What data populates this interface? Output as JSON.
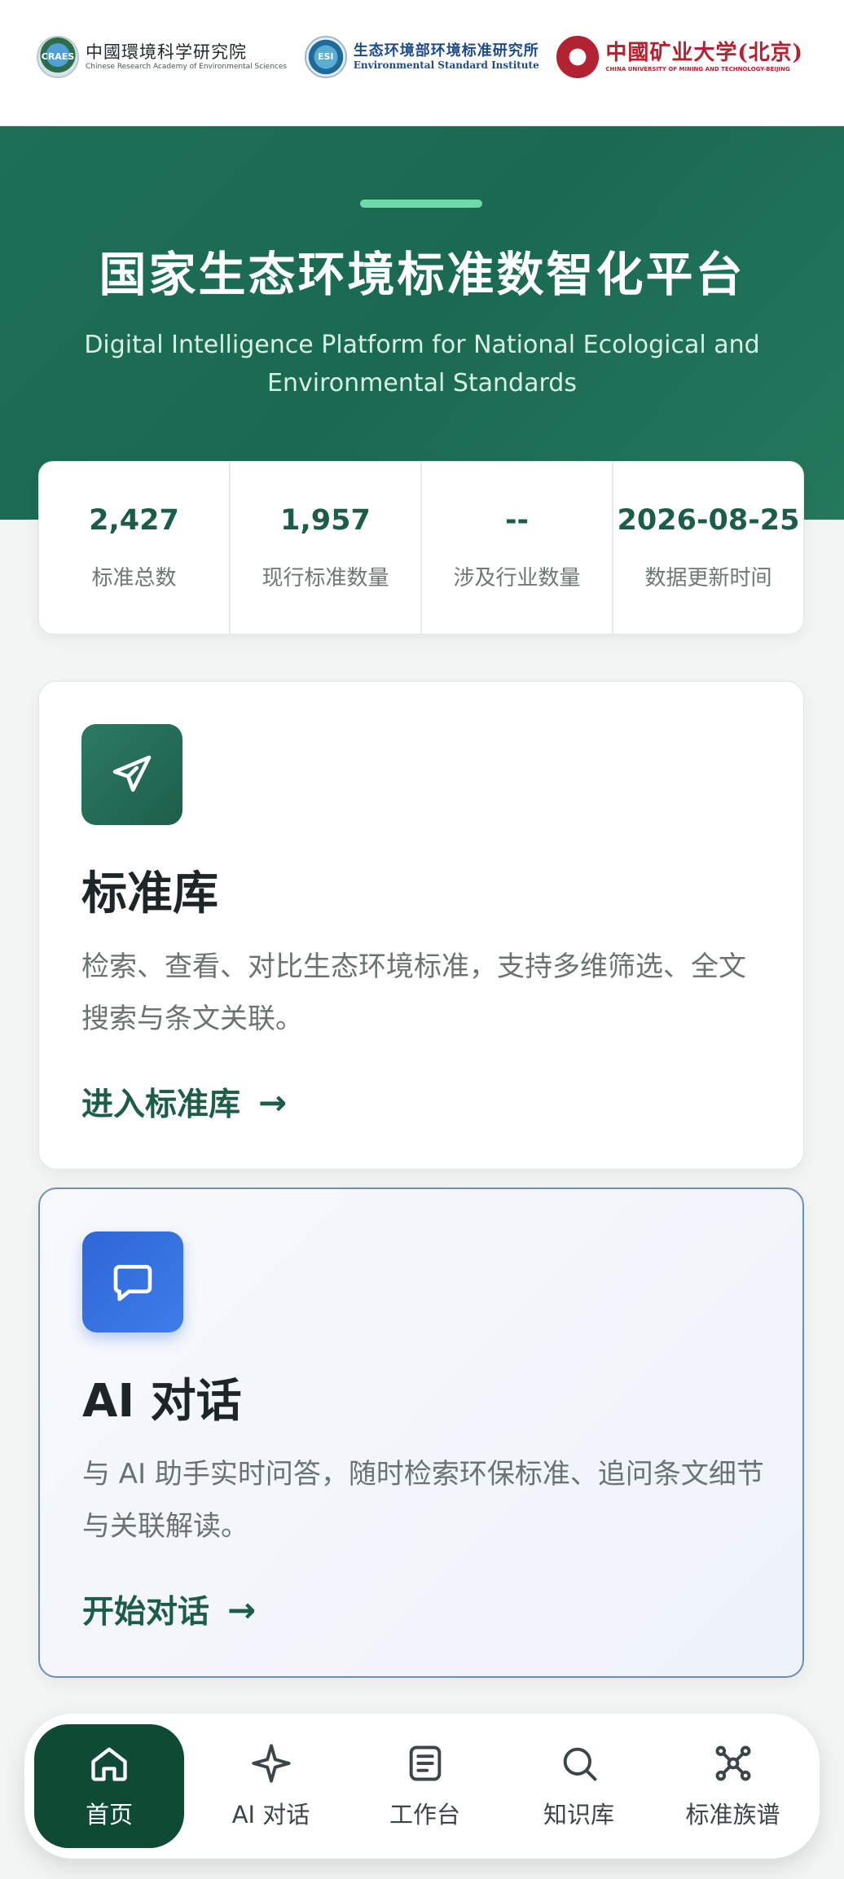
{
  "header": {
    "logos": [
      {
        "cn": "中國環境科学研究院",
        "en": "Chinese Research Academy of Environmental Sciences",
        "seal": "CRAES"
      },
      {
        "cn": "生态环境部环境标准研究所",
        "en": "Environmental Standard Institute",
        "seal": "ESI"
      },
      {
        "cn": "中國矿业大学(北京)",
        "en": "CHINA UNIVERSITY OF MINING AND TECHNOLOGY-BEIJING"
      }
    ]
  },
  "hero": {
    "title": "国家生态环境标准数智化平台",
    "subtitle": "Digital Intelligence Platform for National Ecological and Environmental Standards"
  },
  "stats": [
    {
      "value": "2,427",
      "label": "标准总数"
    },
    {
      "value": "1,957",
      "label": "现行标准数量"
    },
    {
      "value": "--",
      "label": "涉及行业数量"
    },
    {
      "value": "2026-08-25",
      "label": "数据更新时间"
    }
  ],
  "cards": {
    "standards": {
      "icon": "send-icon",
      "title": "标准库",
      "description": "检索、查看、对比生态环境标准，支持多维筛选、全文搜索与条文关联。",
      "link": "进入标准库",
      "arrow": "→"
    },
    "ai": {
      "icon": "chat-bubble-icon",
      "title": "AI 对话",
      "description": "与 AI 助手实时问答，随时检索环保标准、追问条文细节与关联解读。",
      "link": "开始对话",
      "arrow": "→"
    }
  },
  "bottom_nav": [
    {
      "label": "首页",
      "icon": "home-icon",
      "active": true
    },
    {
      "label": "AI 对话",
      "icon": "sparkle-icon",
      "active": false
    },
    {
      "label": "工作台",
      "icon": "document-icon",
      "active": false
    },
    {
      "label": "知识库",
      "icon": "search-icon",
      "active": false
    },
    {
      "label": "标准族谱",
      "icon": "network-icon",
      "active": false
    }
  ],
  "colors": {
    "brand_green": "#1b5d47",
    "hero_green": "#1d6f55",
    "accent_mint": "#6fd9a7",
    "ai_blue": "#2e66d8",
    "nav_active": "#0e4a34"
  }
}
